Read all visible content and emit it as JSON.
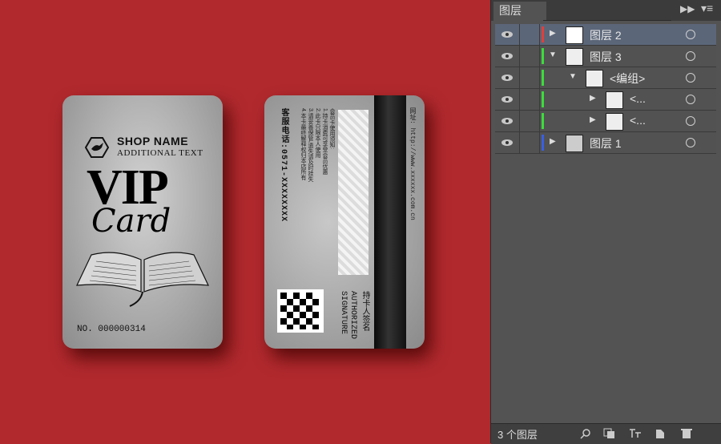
{
  "front_card": {
    "shop_name": "SHOP NAME",
    "additional_text": "ADDITIONAL TEXT",
    "vip": "VIP",
    "card_word": "Card",
    "number": "NO. 000000314"
  },
  "back_card": {
    "url": "网址: http://www.xxxxxx.com.cn",
    "hotline": "客服电话:0571-XXXXXXXX",
    "notes": [
      "会员卡使用须知:",
      "1.持卡消费可享受会员优惠",
      "2.此卡只限本人使用",
      "3.请妥善保管,遗失请及时挂失",
      "4.本卡最终解释权归本店所有"
    ],
    "authorized": [
      "AUTHORIZED",
      "SIGNATURE"
    ],
    "holder_sign": "持卡人签名"
  },
  "layers_panel": {
    "tab_label": "图层",
    "status_text": "3 个图层",
    "colors": {
      "red": "#e0403c",
      "green": "#3ddc3d",
      "blue": "#3a5fe0"
    },
    "layers": [
      {
        "name": "图层 2",
        "expanded": false,
        "selected": true,
        "color": "red"
      },
      {
        "name": "图层 3",
        "expanded": true,
        "selected": false,
        "color": "green"
      },
      {
        "name": "<编组>",
        "expanded": true,
        "selected": false,
        "color": "green"
      },
      {
        "name": "<...",
        "expanded": false,
        "selected": false,
        "color": "green"
      },
      {
        "name": "<...",
        "expanded": false,
        "selected": false,
        "color": "green"
      },
      {
        "name": "图层 1",
        "expanded": false,
        "selected": false,
        "color": "blue"
      }
    ]
  }
}
